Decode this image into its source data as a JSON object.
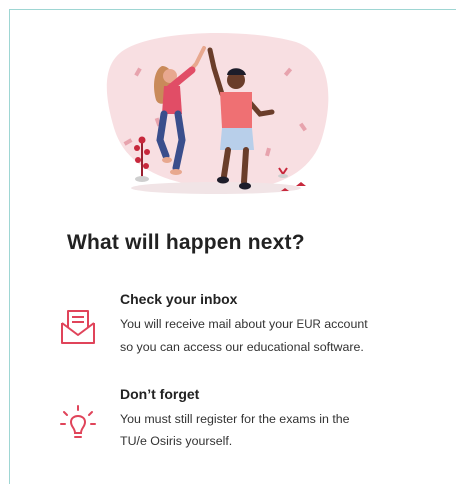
{
  "colors": {
    "accent": "#e0445a",
    "border": "#9ed6d3",
    "text": "#222222",
    "blob": "#f8dfe2"
  },
  "page": {
    "title": "What will happen next?"
  },
  "items": [
    {
      "icon": "mail-envelope-icon",
      "heading": "Check your inbox",
      "body_line1_a": "You will receive mail about your ",
      "body_line1_b": "EUR",
      "body_line1_c": " account",
      "body_line2": "so you can access our educational software."
    },
    {
      "icon": "lightbulb-icon",
      "heading": "Don’t forget",
      "body_line1": "You must still register for the exams in the",
      "body_line2": "TU/e Osiris yourself."
    }
  ]
}
